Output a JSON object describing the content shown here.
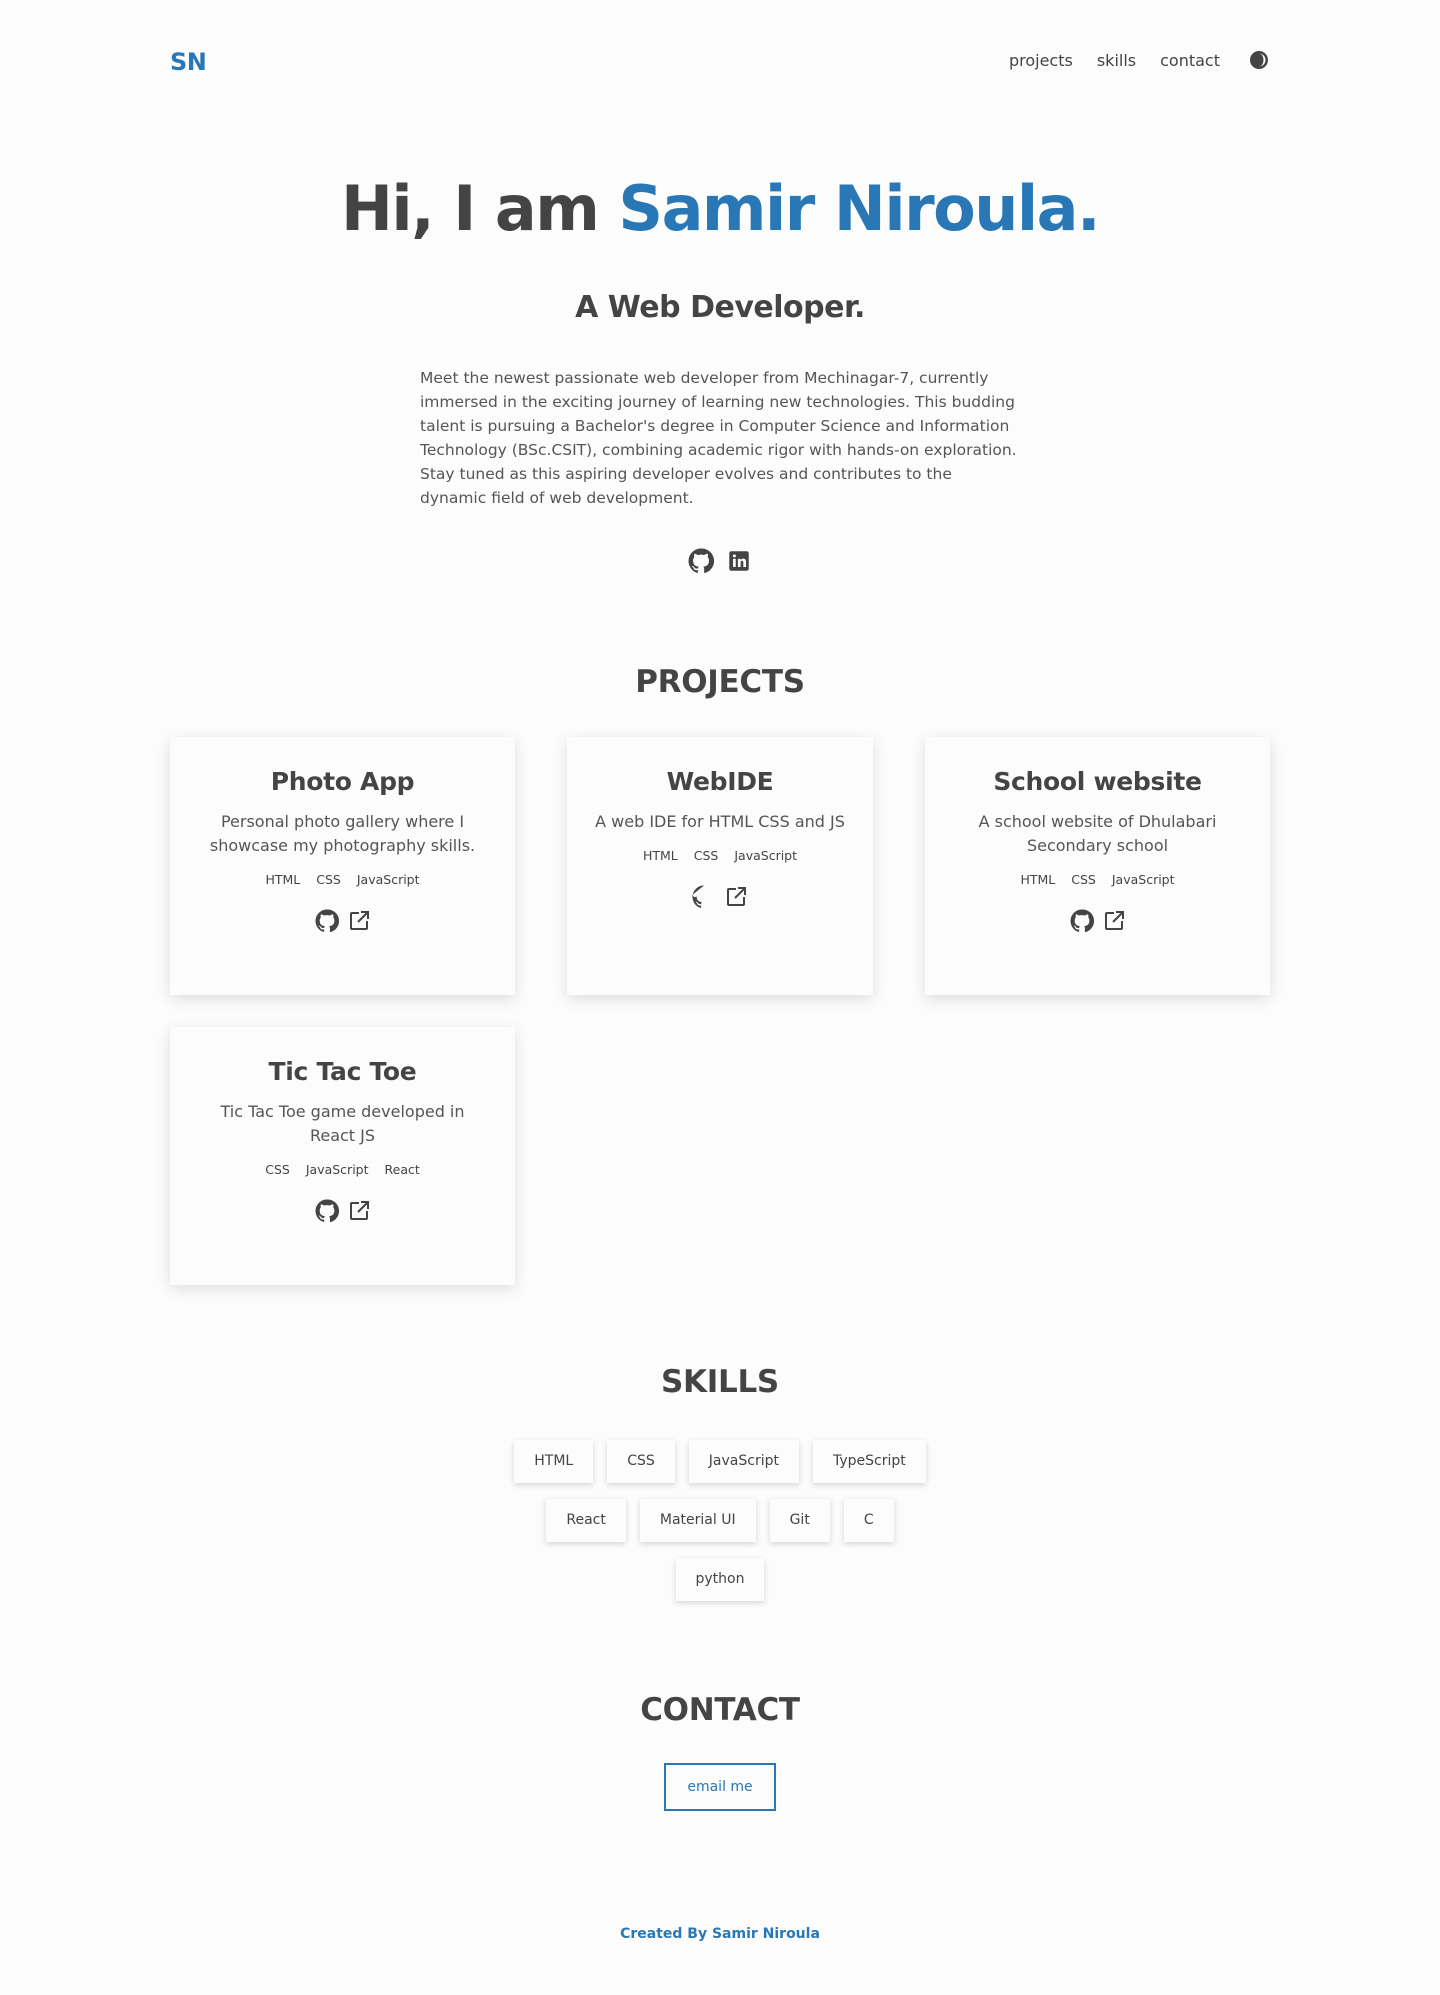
{
  "header": {
    "logo": "SN",
    "nav": [
      "projects",
      "skills",
      "contact"
    ],
    "theme_icon": "moon-icon"
  },
  "hero": {
    "greeting": "Hi, I am ",
    "name": "Samir Niroula.",
    "role": "A Web Developer.",
    "description": "Meet the newest passionate web developer from Mechinagar-7, currently immersed in the exciting journey of learning new technologies. This budding talent is pursuing a Bachelor's degree in Computer Science and Information Technology (BSc.CSIT), combining academic rigor with hands-on exploration. Stay tuned as this aspiring developer evolves and contributes to the dynamic field of web development.",
    "social": [
      "github-icon",
      "linkedin-icon"
    ]
  },
  "projects": {
    "title": "PROJECTS",
    "items": [
      {
        "name": "Photo App",
        "description": "Personal photo gallery where I showcase my photography skills.",
        "tags": [
          "HTML",
          "CSS",
          "JavaScript"
        ]
      },
      {
        "name": "WebIDE",
        "description": "A web IDE for HTML CSS and JS",
        "tags": [
          "HTML",
          "CSS",
          "JavaScript"
        ]
      },
      {
        "name": "School website",
        "description": "A school website of Dhulabari Secondary school",
        "tags": [
          "HTML",
          "CSS",
          "JavaScript"
        ]
      },
      {
        "name": "Tic Tac Toe",
        "description": "Tic Tac Toe game developed in React JS",
        "tags": [
          "CSS",
          "JavaScript",
          "React"
        ]
      }
    ]
  },
  "skills": {
    "title": "SKILLS",
    "rows": [
      [
        "HTML",
        "CSS",
        "JavaScript",
        "TypeScript"
      ],
      [
        "React",
        "Material UI",
        "Git",
        "C"
      ],
      [
        "python"
      ]
    ]
  },
  "contact": {
    "title": "CONTACT",
    "button": "email me"
  },
  "footer": "Created By Samir Niroula",
  "colors": {
    "accent": "#2978b5",
    "text": "#444444",
    "background": "#fcfcfc"
  }
}
